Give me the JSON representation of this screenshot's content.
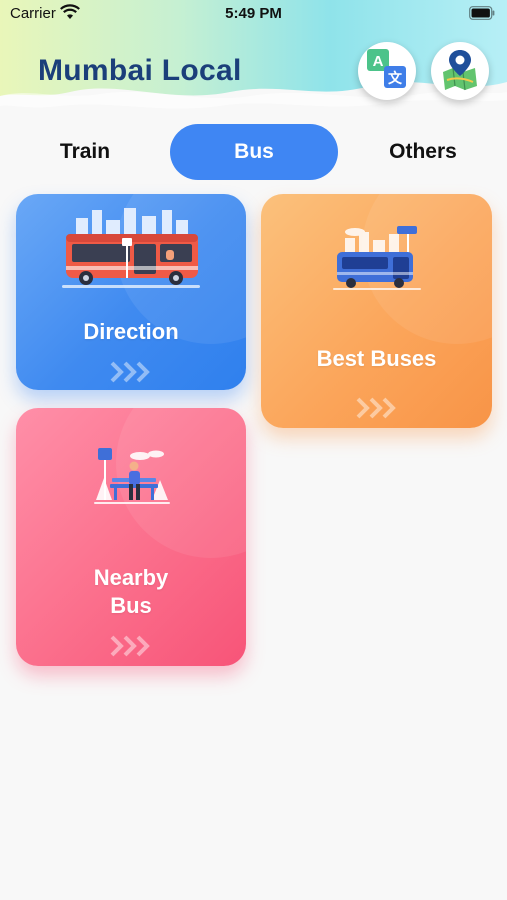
{
  "status_bar": {
    "carrier": "Carrier",
    "time": "5:49 PM"
  },
  "header": {
    "title": "Mumbai Local",
    "translate_icon": "translate-icon",
    "map_icon": "map-pin-icon"
  },
  "tabs": [
    {
      "label": "Train",
      "selected": false
    },
    {
      "label": "Bus",
      "selected": true
    },
    {
      "label": "Others",
      "selected": false
    }
  ],
  "cards": [
    {
      "label": "Direction",
      "color": "#3f8af0"
    },
    {
      "label": "Best Buses",
      "color": "#fba459"
    },
    {
      "label_line1": "Nearby",
      "label_line2": "Bus",
      "color": "#f75478"
    }
  ],
  "colors": {
    "accent": "#3f86f3",
    "title": "#1b3f7a"
  }
}
